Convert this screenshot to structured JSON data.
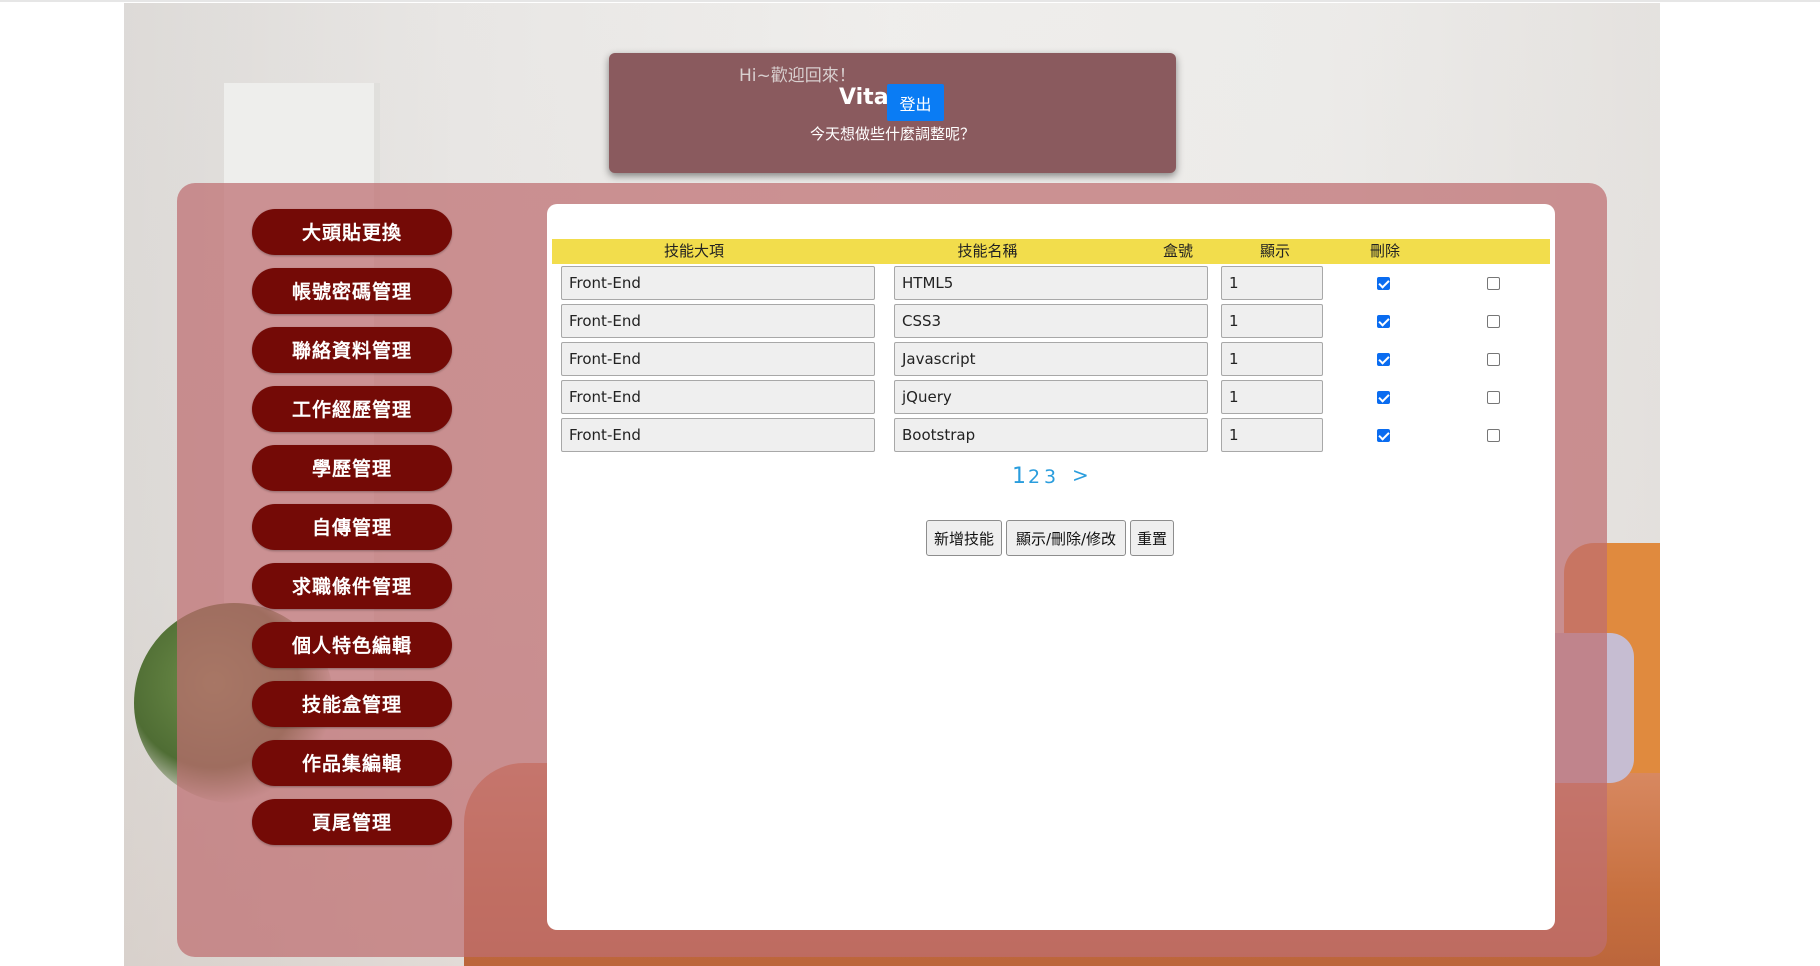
{
  "greeting": {
    "hi": "Hi~歡迎回來！",
    "name": "Vita",
    "logout_label": "登出",
    "subtitle": "今天想做些什麼調整呢？"
  },
  "menu": {
    "items": [
      {
        "label": "大頭貼更換"
      },
      {
        "label": "帳號密碼管理"
      },
      {
        "label": "聯絡資料管理"
      },
      {
        "label": "工作經歷管理"
      },
      {
        "label": "學歷管理"
      },
      {
        "label": "自傳管理"
      },
      {
        "label": "求職條件管理"
      },
      {
        "label": "個人特色編輯"
      },
      {
        "label": "技能盒管理"
      },
      {
        "label": "作品集編輯"
      },
      {
        "label": "頁尾管理"
      }
    ]
  },
  "table": {
    "headers": [
      "技能大項",
      "技能名稱",
      "盒號",
      "顯示",
      "刪除"
    ],
    "rows": [
      {
        "category": "Front-End",
        "name": "HTML5",
        "box": "1",
        "show": true,
        "delete": false
      },
      {
        "category": "Front-End",
        "name": "CSS3",
        "box": "1",
        "show": true,
        "delete": false
      },
      {
        "category": "Front-End",
        "name": "Javascript",
        "box": "1",
        "show": true,
        "delete": false
      },
      {
        "category": "Front-End",
        "name": "jQuery",
        "box": "1",
        "show": true,
        "delete": false
      },
      {
        "category": "Front-End",
        "name": "Bootstrap",
        "box": "1",
        "show": true,
        "delete": false
      }
    ]
  },
  "pagination": {
    "pages": [
      "1",
      "2",
      "3"
    ],
    "current": "1",
    "next": ">"
  },
  "actions": {
    "add_label": "新增技能",
    "update_label": "顯示/刪除/修改",
    "reset_label": "重置"
  },
  "colors": {
    "menu_button": "#740a06",
    "header_row": "#f2dd4c",
    "logout_button": "#0a7cf4",
    "link": "#2a9ddd"
  }
}
